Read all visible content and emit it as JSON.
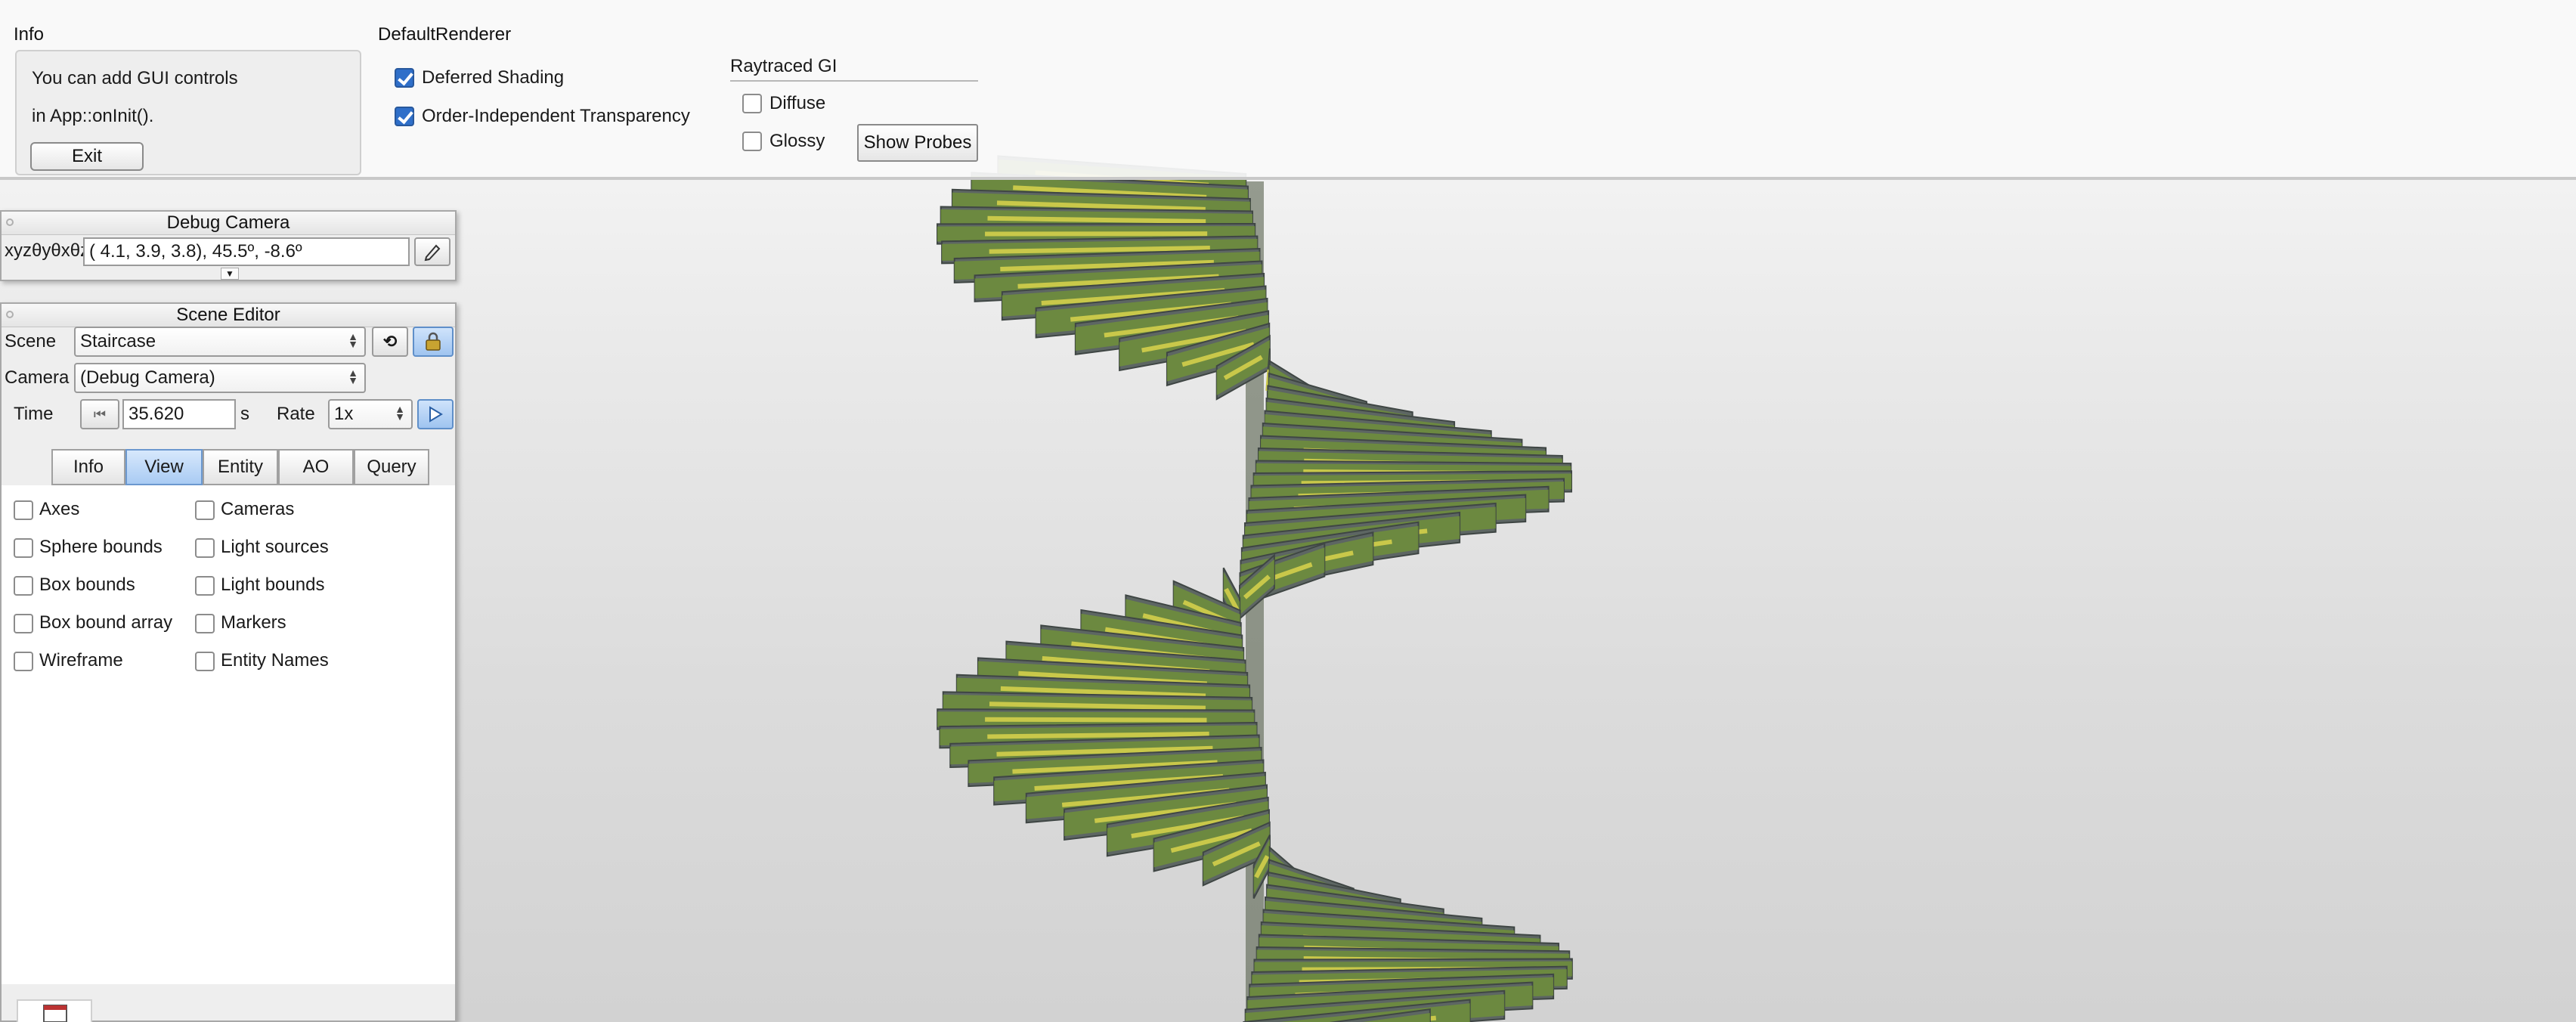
{
  "colors": {
    "accent": "#2f6fc9",
    "step_green": "#6f8f3a",
    "step_yellow": "#c9c84a",
    "step_gray": "#5d6663"
  },
  "info": {
    "title": "Info",
    "line1": "You can add GUI controls",
    "line2": "in App::onInit().",
    "exit_label": "Exit"
  },
  "renderer": {
    "title": "DefaultRenderer",
    "deferred_shading": {
      "label": "Deferred Shading",
      "checked": true
    },
    "oit": {
      "label": "Order-Independent Transparency",
      "checked": true
    },
    "gi_title": "Raytraced GI",
    "diffuse": {
      "label": "Diffuse",
      "checked": false
    },
    "glossy": {
      "label": "Glossy",
      "checked": false
    },
    "show_probes_label": "Show Probes"
  },
  "debug_camera": {
    "title": "Debug Camera",
    "coord_label": "xyzθyθxθz",
    "coord_value": "(  4.1,   3.9,   3.8),  45.5º,  -8.6º",
    "expand_icon": "chevron-down-icon",
    "edit_icon": "pencil-icon"
  },
  "scene_editor": {
    "title": "Scene Editor",
    "scene_label": "Scene",
    "scene_value": "Staircase",
    "reload_icon": "reload-icon",
    "lock_icon": "lock-icon",
    "camera_label": "Camera",
    "camera_value": "(Debug Camera)",
    "time_label": "Time",
    "rewind_icon": "rewind-icon",
    "time_value": "35.620",
    "time_unit": "s",
    "rate_label": "Rate",
    "rate_value": "1x",
    "play_icon": "play-icon",
    "tabs": [
      {
        "label": "Info",
        "active": false
      },
      {
        "label": "View",
        "active": true
      },
      {
        "label": "Entity",
        "active": false
      },
      {
        "label": "AO",
        "active": false
      },
      {
        "label": "Query",
        "active": false
      }
    ],
    "view_options_left": [
      {
        "label": "Axes",
        "checked": false
      },
      {
        "label": "Sphere bounds",
        "checked": false
      },
      {
        "label": "Box bounds",
        "checked": false
      },
      {
        "label": "Box bound array",
        "checked": false
      },
      {
        "label": "Wireframe",
        "checked": false
      }
    ],
    "view_options_right": [
      {
        "label": "Cameras",
        "checked": false
      },
      {
        "label": "Light sources",
        "checked": false
      },
      {
        "label": "Light bounds",
        "checked": false
      },
      {
        "label": "Markers",
        "checked": false
      },
      {
        "label": "Entity Names",
        "checked": false
      }
    ]
  },
  "dock": {
    "icon": "window-icon"
  }
}
